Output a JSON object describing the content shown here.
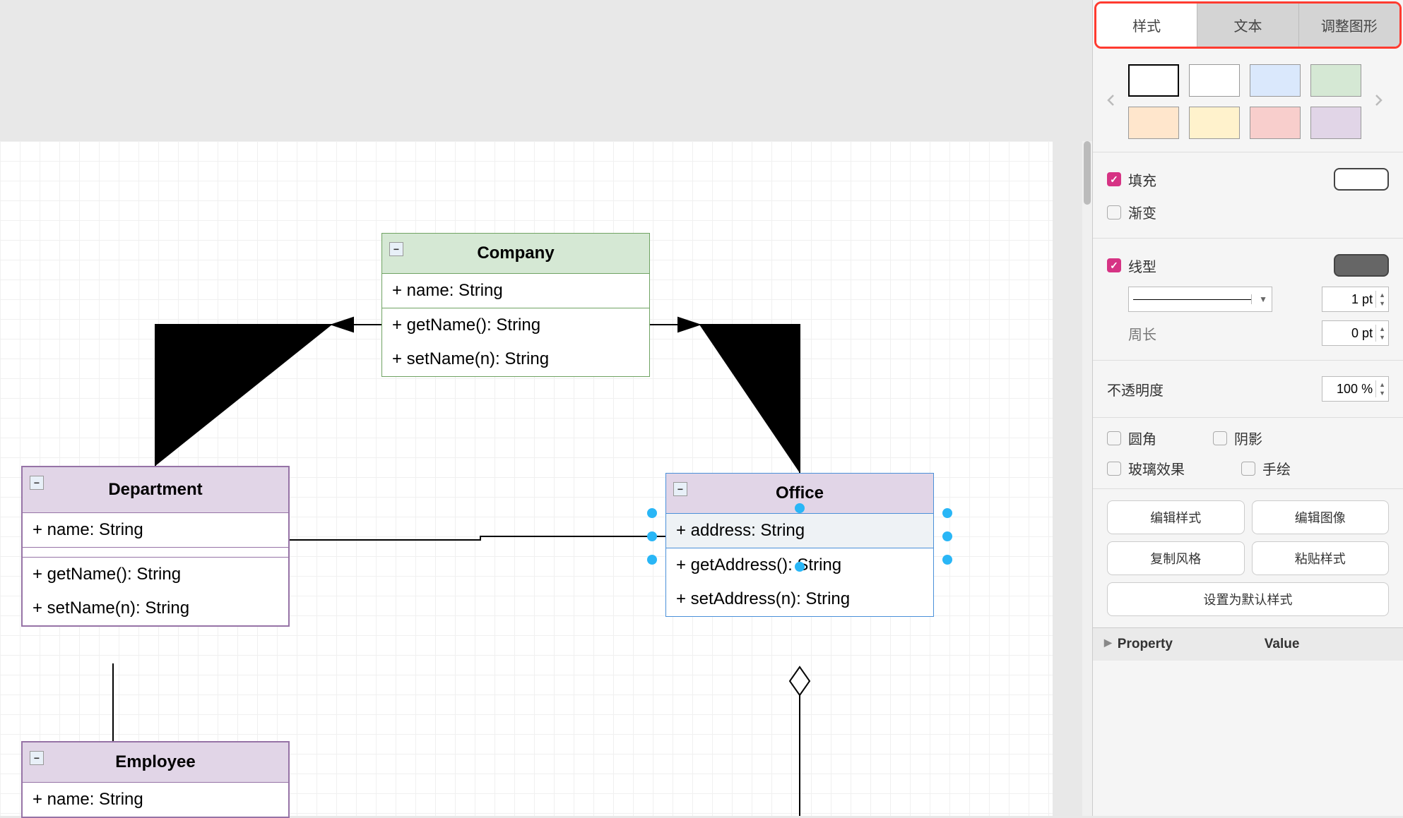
{
  "sidebar": {
    "tabs": {
      "style": "样式",
      "text": "文本",
      "arrange": "调整图形"
    },
    "swatches": [
      {
        "bg": "#ffffff",
        "active": true
      },
      {
        "bg": "#ffffff"
      },
      {
        "bg": "#dae8fc"
      },
      {
        "bg": "#d5e8d4"
      },
      {
        "bg": "#ffe6cc"
      },
      {
        "bg": "#fff2cc"
      },
      {
        "bg": "#f8cecc"
      },
      {
        "bg": "#e1d5e7"
      }
    ],
    "fill_label": "填充",
    "gradient_label": "渐变",
    "line_label": "线型",
    "line_width_value": "1 pt",
    "perimeter_label": "周长",
    "perimeter_value": "0 pt",
    "opacity_label": "不透明度",
    "opacity_value": "100 %",
    "rounded_label": "圆角",
    "shadow_label": "阴影",
    "glass_label": "玻璃效果",
    "sketch_label": "手绘",
    "btn_edit_style": "编辑样式",
    "btn_edit_image": "编辑图像",
    "btn_copy_style": "复制风格",
    "btn_paste_style": "粘贴样式",
    "btn_set_default": "设置为默认样式",
    "prop_table": {
      "col1": "Property",
      "col2": "Value"
    }
  },
  "uml": {
    "company": {
      "title": "Company",
      "attrs": [
        "+ name: String"
      ],
      "ops": [
        "+ getName(): String",
        "+ setName(n): String"
      ]
    },
    "department": {
      "title": "Department",
      "attrs": [
        "+ name: String"
      ],
      "ops": [
        "+ getName(): String",
        "+ setName(n): String"
      ]
    },
    "office": {
      "title": "Office",
      "attrs": [
        "+ address: String"
      ],
      "ops": [
        "+ getAddress(): String",
        "+ setAddress(n): String"
      ]
    },
    "employee": {
      "title": "Employee",
      "attrs": [
        "+ name: String"
      ]
    }
  },
  "chart_data": {
    "type": "uml_class_diagram",
    "classes": [
      {
        "name": "Company",
        "attributes": [
          "+ name: String"
        ],
        "operations": [
          "+ getName(): String",
          "+ setName(n): String"
        ]
      },
      {
        "name": "Department",
        "attributes": [
          "+ name: String"
        ],
        "operations": [
          "+ getName(): String",
          "+ setName(n): String"
        ]
      },
      {
        "name": "Office",
        "attributes": [
          "+ address: String"
        ],
        "operations": [
          "+ getAddress(): String",
          "+ setAddress(n): String"
        ]
      },
      {
        "name": "Employee",
        "attributes": [
          "+ name: String"
        ],
        "operations": []
      }
    ],
    "relationships": [
      {
        "from": "Department",
        "to": "Company",
        "type": "composition"
      },
      {
        "from": "Office",
        "to": "Company",
        "type": "composition"
      },
      {
        "from": "Department",
        "to": "Office",
        "type": "association"
      },
      {
        "from": "Employee",
        "to": "Department",
        "type": "association"
      },
      {
        "from": "Office",
        "to": "below",
        "type": "aggregation_open"
      }
    ]
  }
}
